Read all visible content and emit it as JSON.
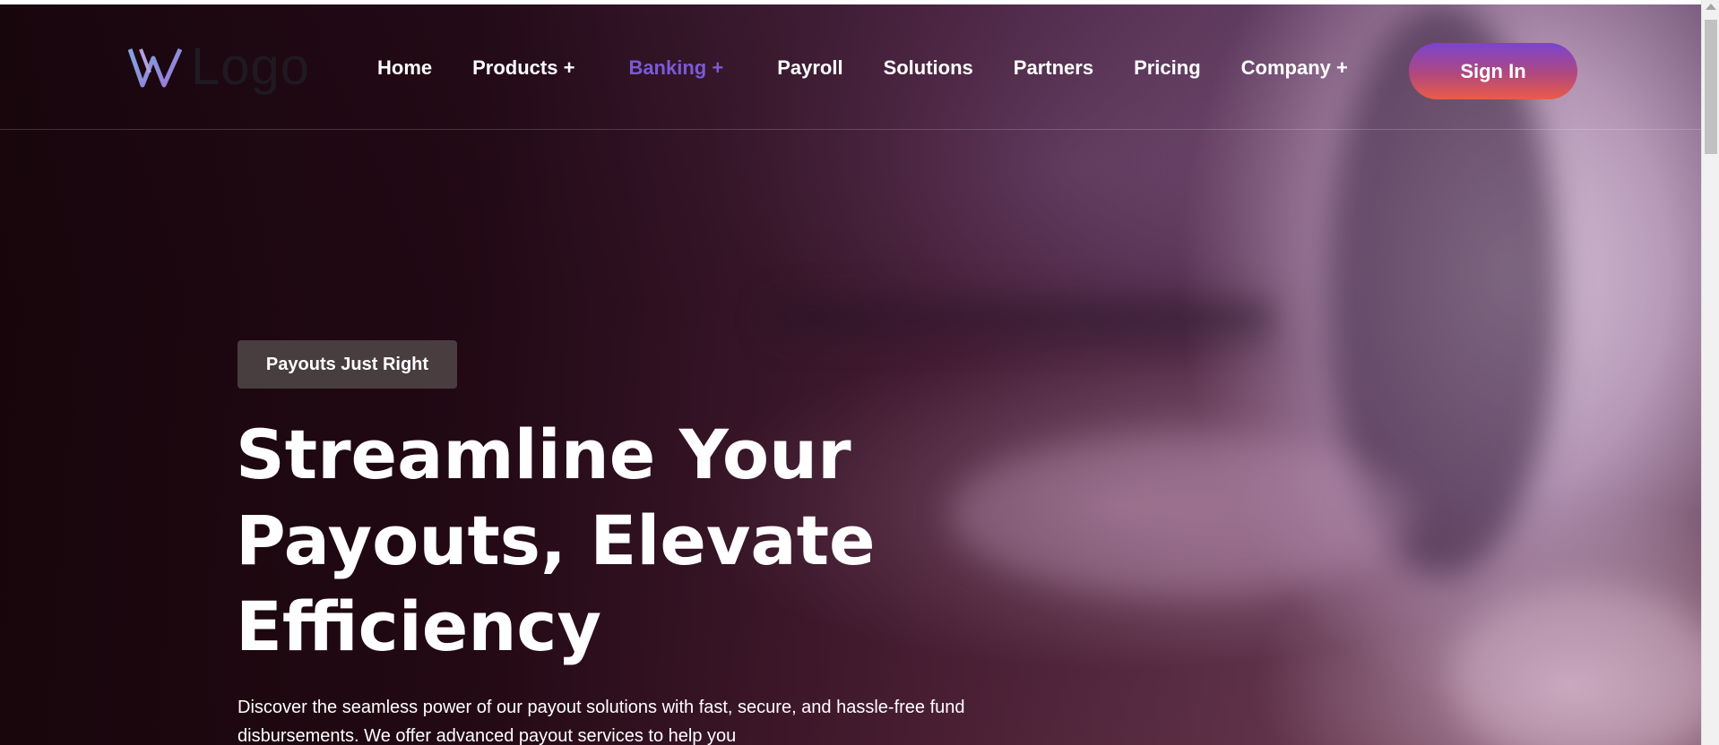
{
  "header": {
    "logo_text": "Logo",
    "logo_icon": "w-monogram-icon",
    "nav": [
      {
        "label": "Home"
      },
      {
        "label": "Products +"
      },
      {
        "label": "Banking +",
        "active": true
      },
      {
        "label": "Payroll"
      },
      {
        "label": "Solutions"
      },
      {
        "label": "Partners"
      },
      {
        "label": "Pricing"
      },
      {
        "label": "Company +"
      }
    ],
    "signin_label": "Sign In"
  },
  "hero": {
    "badge": "Payouts Just Right",
    "headline": [
      "Streamline Your",
      "Payouts, Elevate",
      "Efficiency"
    ],
    "description": "Discover the seamless power of our payout solutions with fast, secure, and hassle-free fund disbursements. We offer advanced payout services to help you"
  },
  "colors": {
    "accent_nav": "#7b5ad6",
    "signin_gradient_top": "#7b44d0",
    "signin_gradient_bottom": "#ec5b48",
    "badge_bg": "#504648"
  },
  "scrollbar": {
    "position": 0
  }
}
